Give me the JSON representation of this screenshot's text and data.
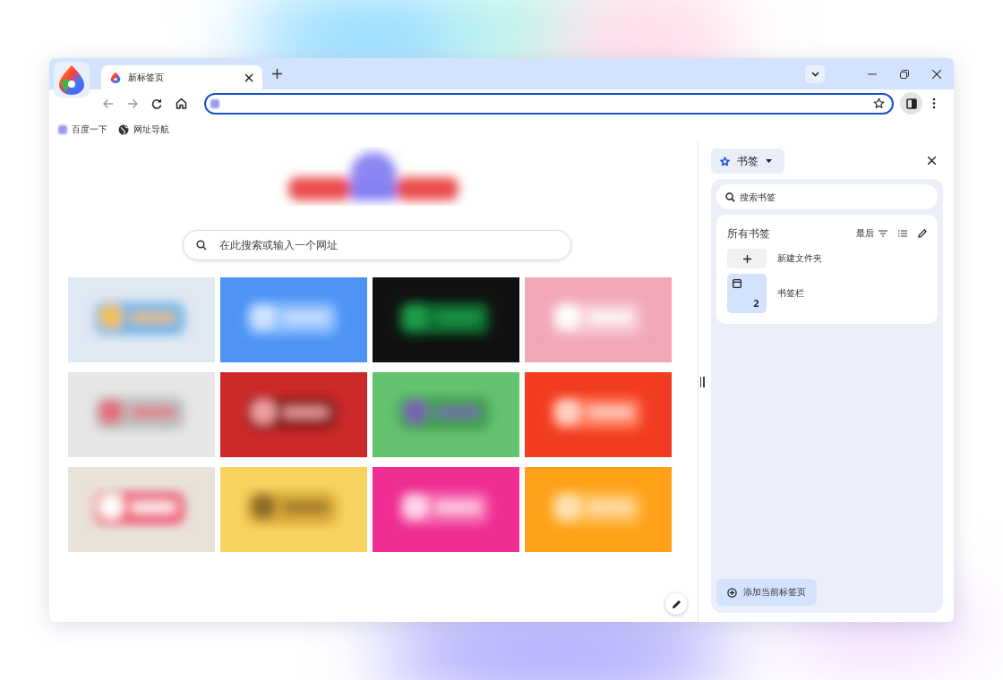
{
  "tabs": [
    {
      "title": "新标签页",
      "selected": true
    }
  ],
  "bookmarks_bar": [
    {
      "label": "百度一下",
      "kind": "favicon"
    },
    {
      "label": "网址导航",
      "kind": "globe"
    }
  ],
  "new_tab": {
    "search": {
      "placeholder": "在此搜索或输入一个网址"
    }
  },
  "side_panel": {
    "title": "书签",
    "search": {
      "placeholder": "搜索书签"
    },
    "section_title": "所有书签",
    "sort_label": "最后",
    "items": [
      {
        "kind": "new-folder",
        "label": "新建文件夹"
      },
      {
        "kind": "folder",
        "label": "书签栏",
        "count": "2"
      }
    ],
    "add_button": "添加当前标签页"
  }
}
